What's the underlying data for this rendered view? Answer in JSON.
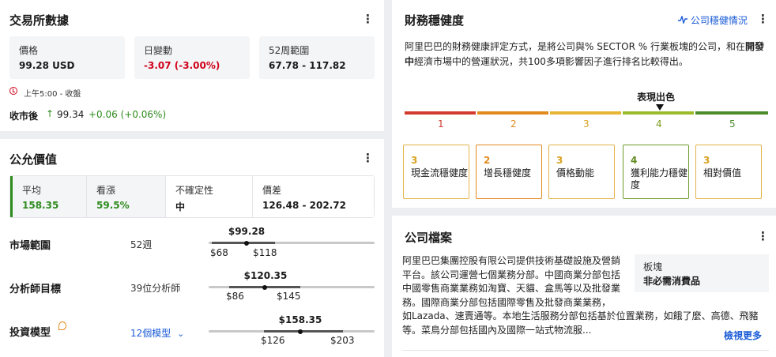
{
  "exchange": {
    "title": "交易所數據",
    "price_label": "價格",
    "price_value": "99.28 USD",
    "change_label": "日變動",
    "change_value": "-3.07 (-3.00%)",
    "range_label": "52周範圍",
    "range_value": "67.78 - 117.82",
    "time_text": "上午5:00 - 收盤",
    "after_hours_label": "收市後",
    "after_hours_arrow": "↑",
    "after_hours_price": "99.34",
    "after_hours_change": "+0.06 (+0.06%)"
  },
  "fair_value": {
    "title": "公允價值",
    "boxes": [
      {
        "label": "平均",
        "value": "158.35"
      },
      {
        "label": "看漲",
        "value": "59.5%"
      },
      {
        "label": "不確定性",
        "value": "中"
      },
      {
        "label": "價差",
        "value": "126.48 - 202.72"
      }
    ],
    "rows": [
      {
        "label": "市場範圍",
        "sub": "52週",
        "top": "$99.28",
        "low": "$68",
        "high": "$118"
      },
      {
        "label": "分析師目標",
        "sub": "39位分析師",
        "top": "$120.35",
        "low": "$86",
        "high": "$145"
      },
      {
        "label": "投資模型",
        "sub": "12個模型",
        "top": "$158.35",
        "low": "$126",
        "high": "$203"
      }
    ],
    "models_chevron": "⌄"
  },
  "health": {
    "title": "財務穩健度",
    "link_label": "公司穩健情況",
    "description_1": "阿里巴巴的財務健康評定方式，是將公司與% SECTOR % 行業板塊的公司，和在",
    "description_bold": "開發中",
    "description_2": "經濟市場中的營運狀況，共100多項影響因子進行排名比較得出。",
    "marker_label": "表現出色",
    "scale": [
      "1",
      "2",
      "3",
      "4",
      "5"
    ],
    "scale_colors": [
      "#d23a2f",
      "#e38a1f",
      "#e7b536",
      "#9bbb2b",
      "#4d8c2a"
    ],
    "factors": [
      {
        "score": "3",
        "name": "現金流穩健度"
      },
      {
        "score": "2",
        "name": "增長穩健度"
      },
      {
        "score": "3",
        "name": "價格動能"
      },
      {
        "score": "4",
        "name": "獲利能力穩健度"
      },
      {
        "score": "3",
        "name": "相對價值"
      }
    ]
  },
  "profile": {
    "title": "公司檔案",
    "text_1": "阿里巴巴集團控股有限公司提供技術基礎設施及營銷平台。該公司運營七個業務分部。中國商業分部包括中國零售商業業務如淘寶、天貓、盒馬等以及批發業務。國際商業分部包括國際零售及批發商業業務，",
    "text_2": "如Lazada、速賣通等。本地生活服務分部包括基於位置業務，如餓了麼、高德、飛豬等。菜鳥分部包括國內及國際一站式物流服...",
    "sector_label": "板塊",
    "sector_value": "非必需消費品",
    "more_label": "檢視更多"
  },
  "menu_icon": "⋮"
}
